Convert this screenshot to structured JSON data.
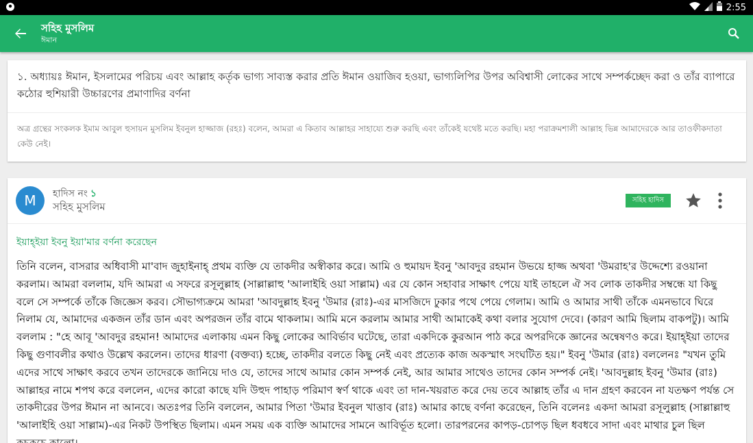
{
  "status_bar": {
    "time": "2:55",
    "icons": [
      "wifi-icon",
      "signal-icon",
      "battery-icon"
    ]
  },
  "app_bar": {
    "title": "সহিহ মুসলিম",
    "subtitle": "ঈমান",
    "back_icon": "arrow-left-icon",
    "search_icon": "search-icon"
  },
  "chapter": {
    "title": "১. অধ্যায়ঃ ঈমান, ইসলামের পরিচয় এবং আল্লাহ কর্তৃক ভাগ্য সাব্যস্ত করার প্রতি ঈমান ওয়াজিব হওয়া, ভাগ্যলিপির উপর অবিশ্বাসী লোকের সাথে সম্পর্কচ্ছেদ করা ও তাঁর ব্যাপারে কঠোর হুশিয়ারী উচ্চারণের প্রমাণাদির বর্ণনা",
    "intro": "অত্র গ্রন্থের সংকলক ইমাম আবুল হুসায়ন মুসলিম ইবনুল হাজ্জাজ (রহঃ) বলেন, আমরা এ কিতাব আল্লাহর সাহায্যে শুরু করছি এবং তাঁকেই যথেষ্ট মতে করছি। মহা পরাক্রমশালী আল্লাহ ভিন্ন আমাদেরকে আর তাওফীকদাতা কেউ নেই।"
  },
  "hadith": {
    "avatar_letter": "M",
    "number_label": "হাদিস নং",
    "number": "১",
    "book": "সহিহ মুসলিম",
    "grade": "সহিহ হাদিস",
    "star_icon": "star-icon",
    "more_icon": "more-vert-icon",
    "narrator": "ইয়াহ্ইয়া ইবনু ইয়া'মার বর্ণনা করেছেন",
    "text": "তিনি বলেন, বাসরার অধিবাসী মা'বাদ জুহাইনাহ্ প্রথম ব্যক্তি যে তাকদীর অস্বীকার করে। আমি ও হুমায়দ ইবনু 'আবদুর রহমান উভয়ে হাজ্জ অথবা 'উমরাহ'র উদ্দেশ্যে রওয়ানা করলাম। আমরা বললাম, যদি আমরা এ সফরে রসূলুল্লাহ (সাল্লাল্লাহু 'আলাইহি ওয়া সাল্লাম) এর যে কোন সহাবার সাক্ষাৎ পেয়ে যাই তাহলে ঐ সব লোক তাকদীর সম্বন্ধে যা কিছু বলে সে সম্পর্কে তাঁকে জিজ্ঞেস করব। সৌভাগ্যক্রমে আমরা 'আবদুল্লাহ ইবনু 'উমার (রাঃ)-এর মাসজিদে ঢুকার পথে পেয়ে গেলাম। আমি ও আমার সাথী তাঁকে এমনভাবে ঘিরে নিলাম যে, আমাদের একজন তাঁর ডান এবং অপরজন তাঁর বামে থাকলাম। আমি মনে করলাম আমার সাথী আমাকেই কথা বলার সুযোগ দেবে। (কারণ আমি ছিলাম বাকপটু)। আমি বললাম : \"হে আবূ 'আবদুর রহমান! আমাদের এলাকায় এমন কিছু লোকের আবির্ভাব ঘটেছে, তারা একদিকে কুরআন পাঠ করে অপরদিকে জ্ঞানের অন্বেষণও করে। ইয়াহ্ইয়া তাদের কিছু গুণাবলীর কথাও উল্লেখ করলেন। তাদের ধারণা (বক্তব্য) হচ্ছে, তাকদীর বলতে কিছু নেই এবং প্রত্যেক কাজ অকস্মাৎ সংঘটিত হয়।\" ইবনু 'উমার (রাঃ) বললেনঃ \"যখন তুমি এদের সাথে সাক্ষাৎ করবে তখন তাদেরকে জানিয়ে দাও যে, তাদের সাথে আমার কোন সম্পর্ক নেই, আর আমার সাথেও তাদের কোন সম্পর্ক নেই। 'আবদুল্লাহ ইবনু 'উমার (রাঃ) আল্লাহর নামে শপথ করে বললেন, এদের কারো কাছে যদি উহুদ পাহাড় পরিমাণ স্বর্ণ থাকে এবং তা দান-খয়রাত করে দেয় তবে আল্লাহ তাঁর এ দান গ্রহণ করবেন না যতক্ষণ পর্যন্ত সে তাকদীরের উপর ঈমান না আনবে। অতঃপর তিনি বললেন, আমার পিতা 'উমার ইবনুল খাত্তাব (রাঃ) আমার কাছে বর্ণনা করেছেন, তিনি বলেনঃ একদা আমরা রসূলুল্লাহ (সাল্লাল্লাহু 'আলাইহি ওয়া সাল্লাম)-এর নিকট উপস্থিত ছিলাম। এমন সময় এক ব্যক্তি আমাদের সামনে আবির্ভূত হলো। তারপরনের কাপড়-চোপড় ছিল ধবধবে সাদা এবং মাথার চুল ছিল কুচকুচে কালো।"
  },
  "colors": {
    "primary": "#20b069",
    "avatar": "#2a8bd0",
    "badge": "#2fb45e",
    "narrator": "#1a9b5a"
  }
}
